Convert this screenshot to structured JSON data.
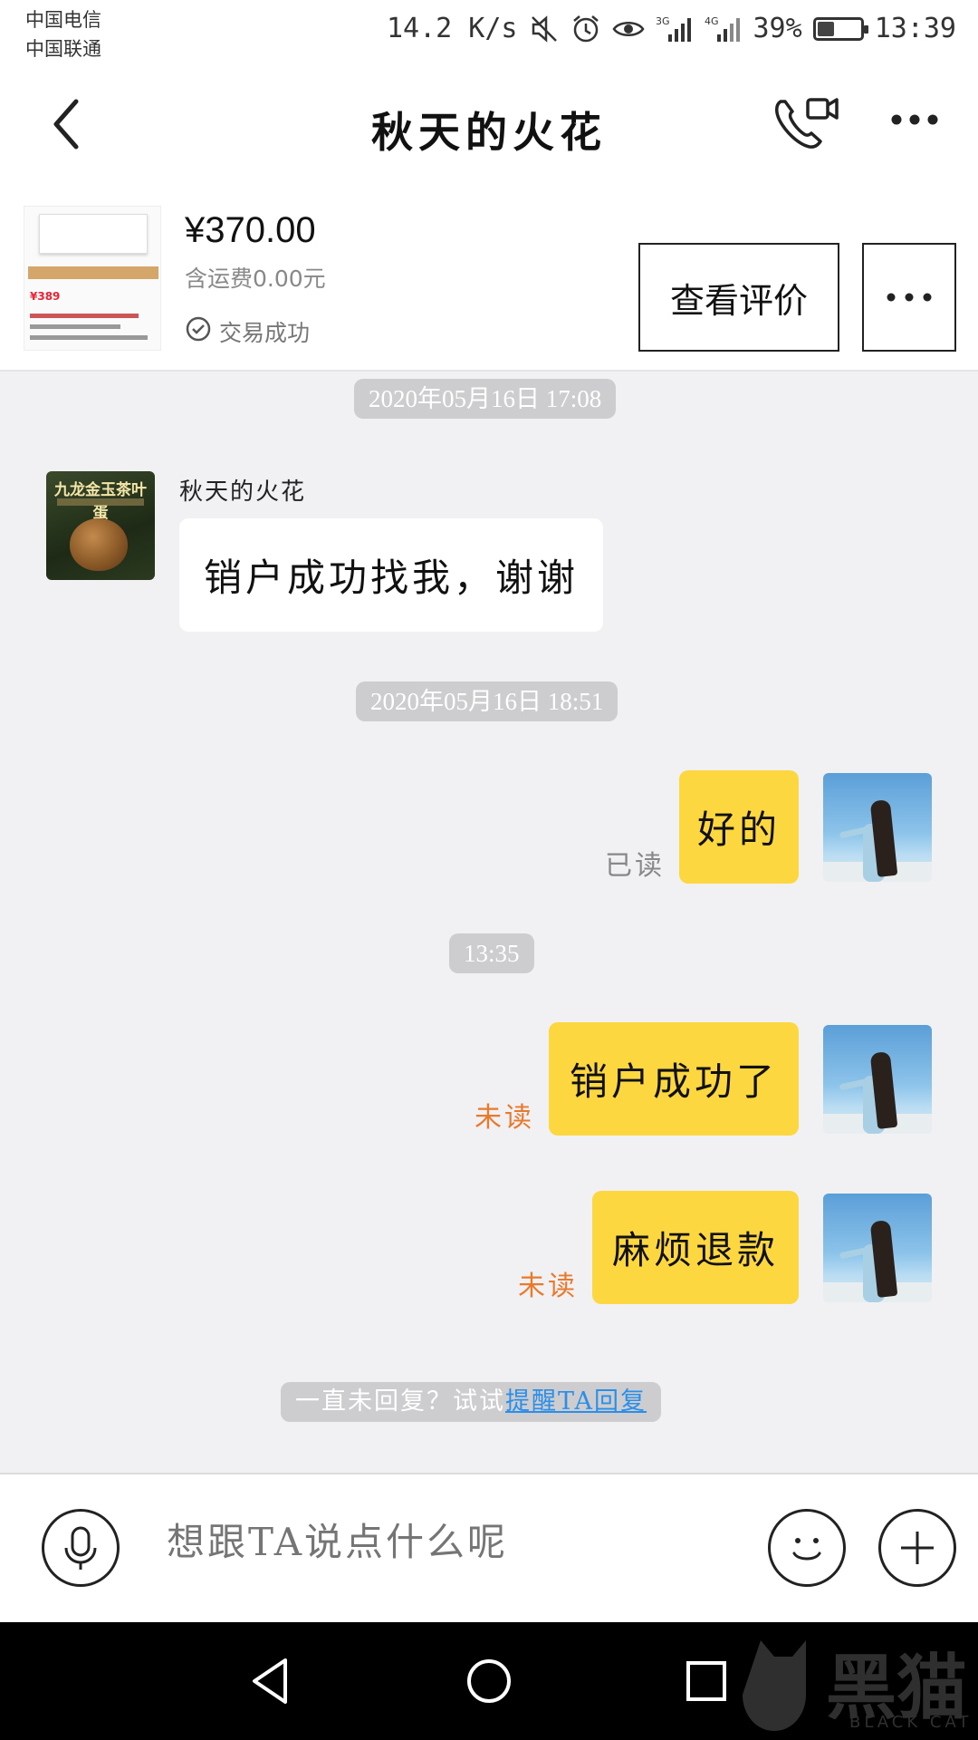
{
  "status_bar": {
    "carriers": [
      "中国电信",
      "中国联通"
    ],
    "network_speed": "14.2 K/s",
    "signal_labels": [
      "3G",
      "4G"
    ],
    "battery": "39%",
    "battery_level": 0.39,
    "time": "13:39"
  },
  "header": {
    "title": "秋天的火花",
    "icons": [
      "back-icon",
      "video-call-icon",
      "more-icon"
    ]
  },
  "product": {
    "thumb_price": "¥389",
    "price": "¥370.00",
    "shipping": "含运费0.00元",
    "status": "交易成功",
    "review_button": "查看评价"
  },
  "chat": {
    "messages": [
      {
        "timestamp": "2020年05月16日 17:08"
      },
      {
        "sender": "秋天的火花",
        "avatar_title": "九龙金玉茶叶蛋",
        "text": "销户成功找我，谢谢",
        "direction": "in"
      },
      {
        "timestamp": "2020年05月16日 18:51"
      },
      {
        "text": "好的",
        "direction": "out",
        "read_status": "已读"
      },
      {
        "timestamp": "13:35"
      },
      {
        "text": "销户成功了",
        "direction": "out",
        "read_status": "未读"
      },
      {
        "text": "麻烦退款",
        "direction": "out",
        "read_status": "未读"
      }
    ],
    "remind_prefix": "一直未回复？试试",
    "remind_link": "提醒TA回复"
  },
  "input": {
    "placeholder": "想跟TA说点什么呢"
  },
  "watermark": {
    "text": "黑猫",
    "sub": "BLACK CAT"
  },
  "colors": {
    "outgoing_bubble": "#fcd740",
    "unread": "#e87a2e",
    "link": "#2b8ee8"
  }
}
